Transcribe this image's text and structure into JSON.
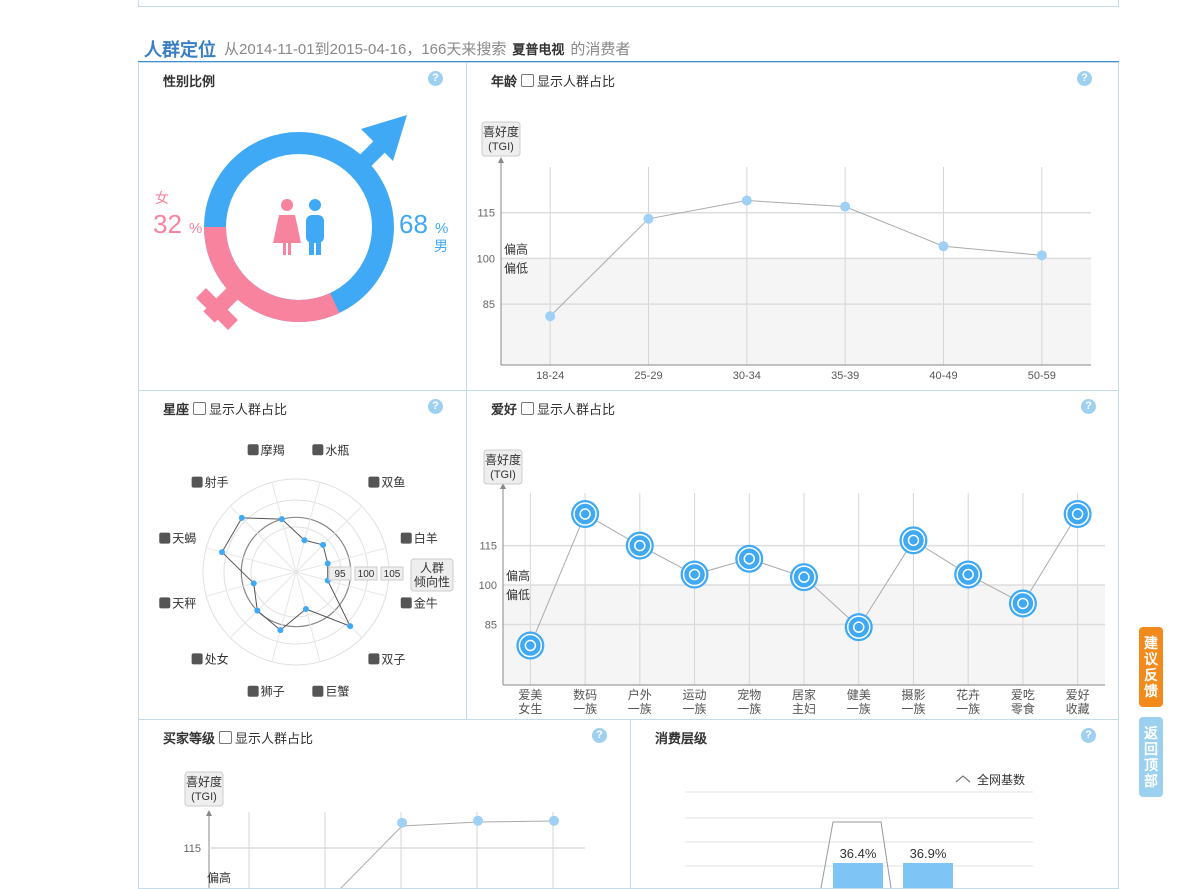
{
  "section": {
    "title": "人群定位",
    "desc_prefix": "从2014-11-01到2015-04-16，166天来搜索",
    "brand": "夏普电视",
    "desc_suffix": "的消费者"
  },
  "panels": {
    "gender": {
      "title": "性别比例"
    },
    "age": {
      "title": "年龄",
      "checkbox": "显示人群占比"
    },
    "zodiac": {
      "title": "星座",
      "checkbox": "显示人群占比"
    },
    "hobby": {
      "title": "爱好",
      "checkbox": "显示人群占比"
    },
    "buyer": {
      "title": "买家等级",
      "checkbox": "显示人群占比"
    },
    "consume": {
      "title": "消费层级"
    }
  },
  "help_label": "?",
  "tgi_label": [
    "喜好度",
    "(TGI)"
  ],
  "high_label": "偏高",
  "low_label": "偏低",
  "colors": {
    "female": "#f7839f",
    "male": "#3fa9f5",
    "line": "#aaaaaa",
    "point": "#9fd0f5",
    "band": "#f5f5f5"
  },
  "chart_data": [
    {
      "type": "pie",
      "categories": [
        "女",
        "男"
      ],
      "values": [
        32,
        68
      ],
      "unit": "%"
    },
    {
      "type": "line",
      "ylabel": "喜好度 (TGI)",
      "categories": [
        "18-24",
        "25-29",
        "30-34",
        "35-39",
        "40-49",
        "50-59"
      ],
      "values": [
        81,
        113,
        119,
        117,
        104,
        101
      ],
      "yticks": [
        85,
        100,
        115
      ],
      "ylim": [
        65,
        130
      ]
    },
    {
      "type": "radar",
      "categories": [
        "水瓶",
        "双鱼",
        "白羊",
        "金牛",
        "双子",
        "巨蟹",
        "狮子",
        "处女",
        "天秤",
        "天蝎",
        "射手",
        "摩羯"
      ],
      "values": [
        96,
        97,
        96,
        96,
        104,
        97,
        101,
        100,
        98,
        104,
        104,
        100
      ],
      "rings": [
        95,
        100,
        105
      ],
      "ring_label": [
        "人群",
        "倾向性"
      ]
    },
    {
      "type": "line",
      "ylabel": "喜好度 (TGI)",
      "categories": [
        [
          "爱美",
          "女生"
        ],
        [
          "数码",
          "一族"
        ],
        [
          "户外",
          "一族"
        ],
        [
          "运动",
          "一族"
        ],
        [
          "宠物",
          "一族"
        ],
        [
          "居家",
          "主妇"
        ],
        [
          "健美",
          "一族"
        ],
        [
          "摄影",
          "一族"
        ],
        [
          "花卉",
          "一族"
        ],
        [
          "爱吃",
          "零食"
        ],
        [
          "爱好",
          "收藏"
        ]
      ],
      "values": [
        77,
        127,
        115,
        104,
        110,
        103,
        84,
        117,
        104,
        93,
        127
      ],
      "yticks": [
        85,
        100,
        115
      ],
      "ylim": [
        62,
        135
      ]
    },
    {
      "type": "line",
      "ylabel": "喜好度 (TGI)",
      "values": [
        null,
        null,
        null,
        122,
        123,
        123
      ],
      "yticks": [
        115
      ]
    },
    {
      "type": "bar",
      "legend": "全网基数",
      "values": [
        36.4,
        36.9
      ],
      "unit": "%"
    }
  ],
  "side_buttons": {
    "feedback": "建议反馈",
    "top": "返回顶部"
  }
}
